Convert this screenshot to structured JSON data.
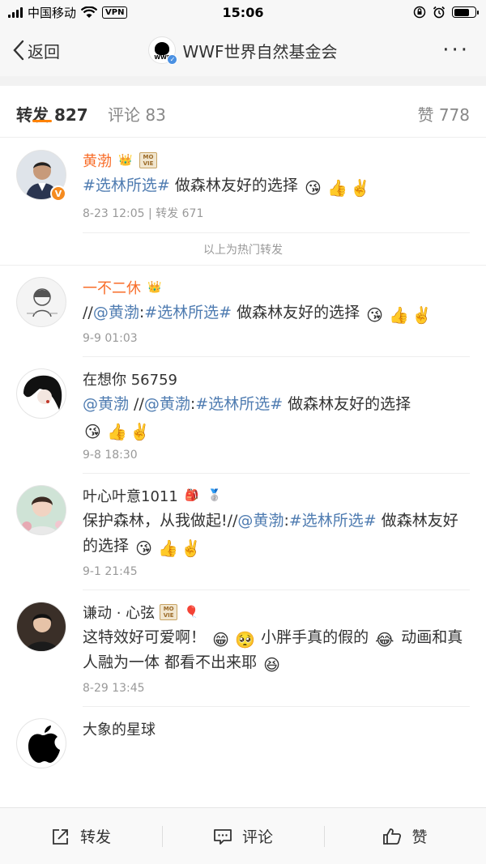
{
  "status_bar": {
    "carrier": "中国移动",
    "vpn": "VPN",
    "time": "15:06"
  },
  "nav": {
    "back_label": "返回",
    "title": "WWF世界自然基金会",
    "logo_text": "WWF"
  },
  "tabs": {
    "repost": "转发 827",
    "comment": "评论 83",
    "like": "赞 778"
  },
  "hot_divider": "以上为热门转发",
  "posts": [
    {
      "username": "黄渤",
      "content_link": "#选林所选#",
      "content_text": " 做森林友好的选择",
      "meta": "8-23 12:05 | 转发 671"
    },
    {
      "username": "一不二休",
      "content_prefix": "//",
      "content_link1": "@黄渤",
      "content_sep": ":",
      "content_link2": "#选林所选#",
      "content_text": " 做森林友好的选择",
      "meta": "9-9 01:03"
    },
    {
      "username": "在想你 56759",
      "content_link1": "@黄渤",
      "content_prefix": " //",
      "content_link2": "@黄渤",
      "content_sep": ":",
      "content_link3": "#选林所选#",
      "content_text": " 做森林友好的选择",
      "meta": "9-8 18:30"
    },
    {
      "username": "叶心叶意1011",
      "content_text1": "保护森林，从我做起!//",
      "content_link1": "@黄渤",
      "content_sep": ":",
      "content_link2": "#选林所选#",
      "content_text2": " 做森林友好的选择",
      "meta": "9-1 21:45"
    },
    {
      "username": "谦动 · 心弦",
      "content_text1": "这特效好可爱啊！",
      "content_text2": " 小胖手真的假的",
      "content_text3": " 动画和真人融为一体 都看不出来耶",
      "meta": "8-29 13:45"
    },
    {
      "username": "大象的星球"
    }
  ],
  "bottom_bar": {
    "repost": "转发",
    "comment": "评论",
    "like": "赞"
  },
  "colors": {
    "accent": "#ff8200",
    "link": "#4f7cb1",
    "vip_name": "#f86d29"
  }
}
